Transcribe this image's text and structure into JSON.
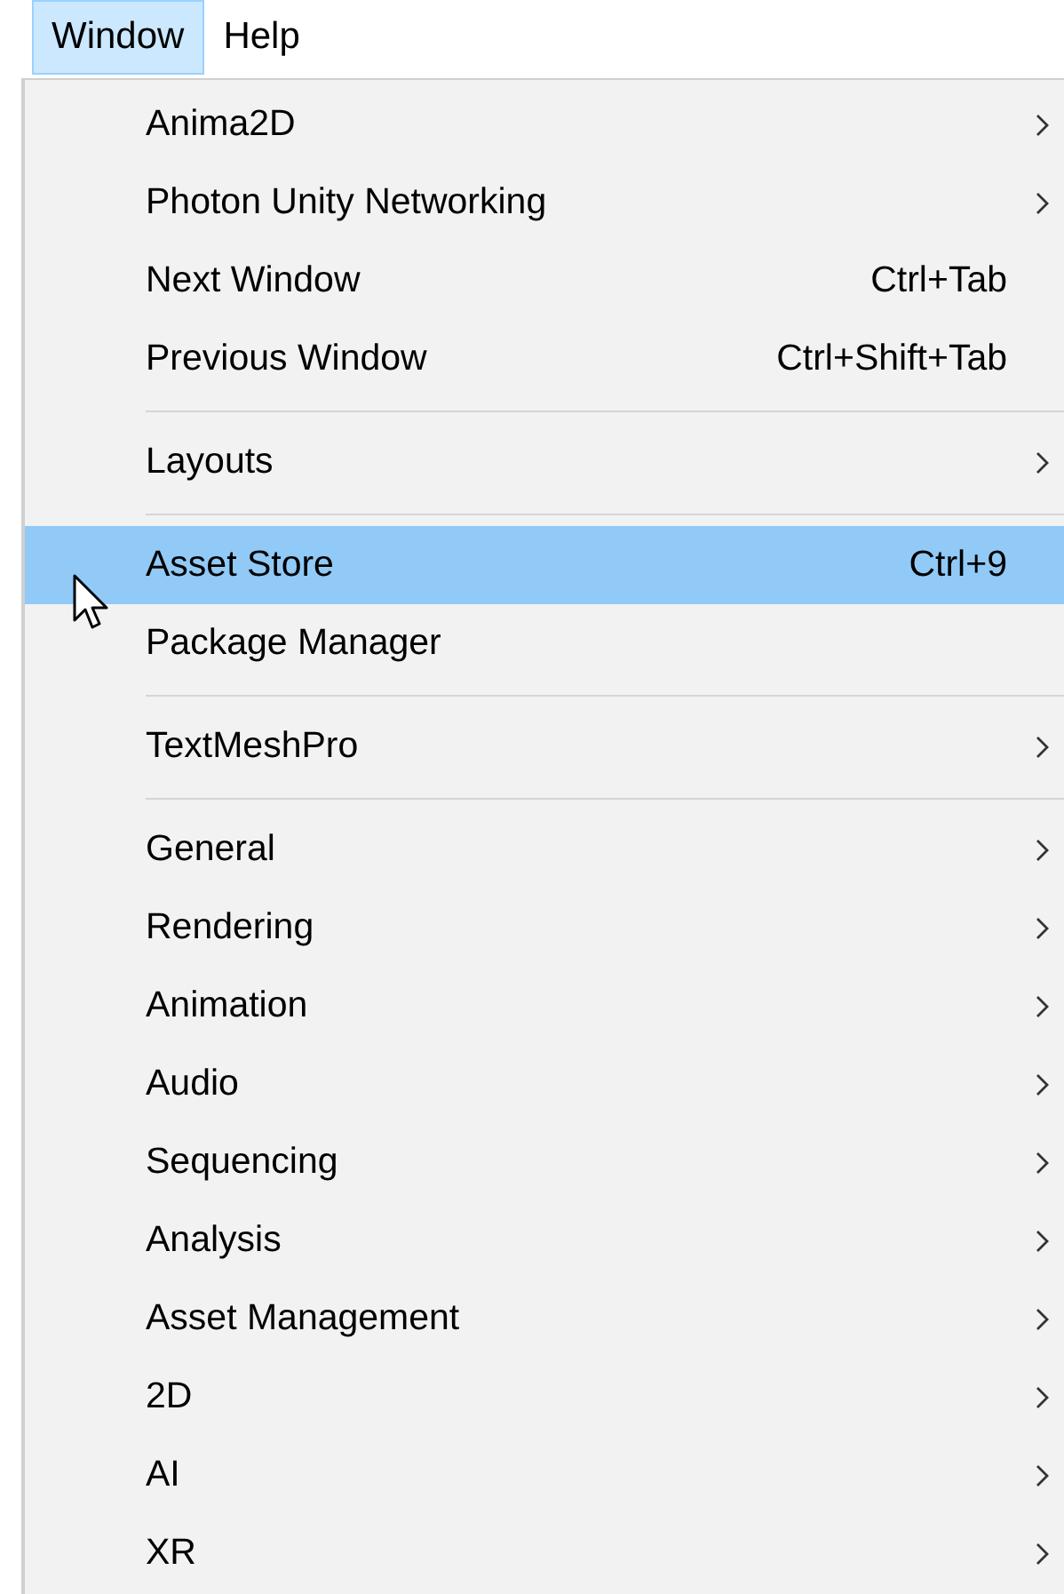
{
  "menubar": [
    {
      "label": "Window",
      "selected": true
    },
    {
      "label": "Help",
      "selected": false
    }
  ],
  "menu": {
    "items": [
      {
        "kind": "item",
        "label": "Anima2D",
        "submenu": true,
        "selected": false
      },
      {
        "kind": "item",
        "label": "Photon Unity Networking",
        "submenu": true,
        "selected": false
      },
      {
        "kind": "item",
        "label": "Next Window",
        "shortcut": "Ctrl+Tab",
        "submenu": false,
        "selected": false
      },
      {
        "kind": "item",
        "label": "Previous Window",
        "shortcut": "Ctrl+Shift+Tab",
        "submenu": false,
        "selected": false
      },
      {
        "kind": "separator"
      },
      {
        "kind": "item",
        "label": "Layouts",
        "submenu": true,
        "selected": false
      },
      {
        "kind": "separator"
      },
      {
        "kind": "item",
        "label": "Asset Store",
        "shortcut": "Ctrl+9",
        "submenu": false,
        "selected": true
      },
      {
        "kind": "item",
        "label": "Package Manager",
        "submenu": false,
        "selected": false
      },
      {
        "kind": "separator"
      },
      {
        "kind": "item",
        "label": "TextMeshPro",
        "submenu": true,
        "selected": false
      },
      {
        "kind": "separator"
      },
      {
        "kind": "item",
        "label": "General",
        "submenu": true,
        "selected": false
      },
      {
        "kind": "item",
        "label": "Rendering",
        "submenu": true,
        "selected": false
      },
      {
        "kind": "item",
        "label": "Animation",
        "submenu": true,
        "selected": false
      },
      {
        "kind": "item",
        "label": "Audio",
        "submenu": true,
        "selected": false
      },
      {
        "kind": "item",
        "label": "Sequencing",
        "submenu": true,
        "selected": false
      },
      {
        "kind": "item",
        "label": "Analysis",
        "submenu": true,
        "selected": false
      },
      {
        "kind": "item",
        "label": "Asset Management",
        "submenu": true,
        "selected": false
      },
      {
        "kind": "item",
        "label": "2D",
        "submenu": true,
        "selected": false
      },
      {
        "kind": "item",
        "label": "AI",
        "submenu": true,
        "selected": false
      },
      {
        "kind": "item",
        "label": "XR",
        "submenu": true,
        "selected": false
      }
    ]
  }
}
